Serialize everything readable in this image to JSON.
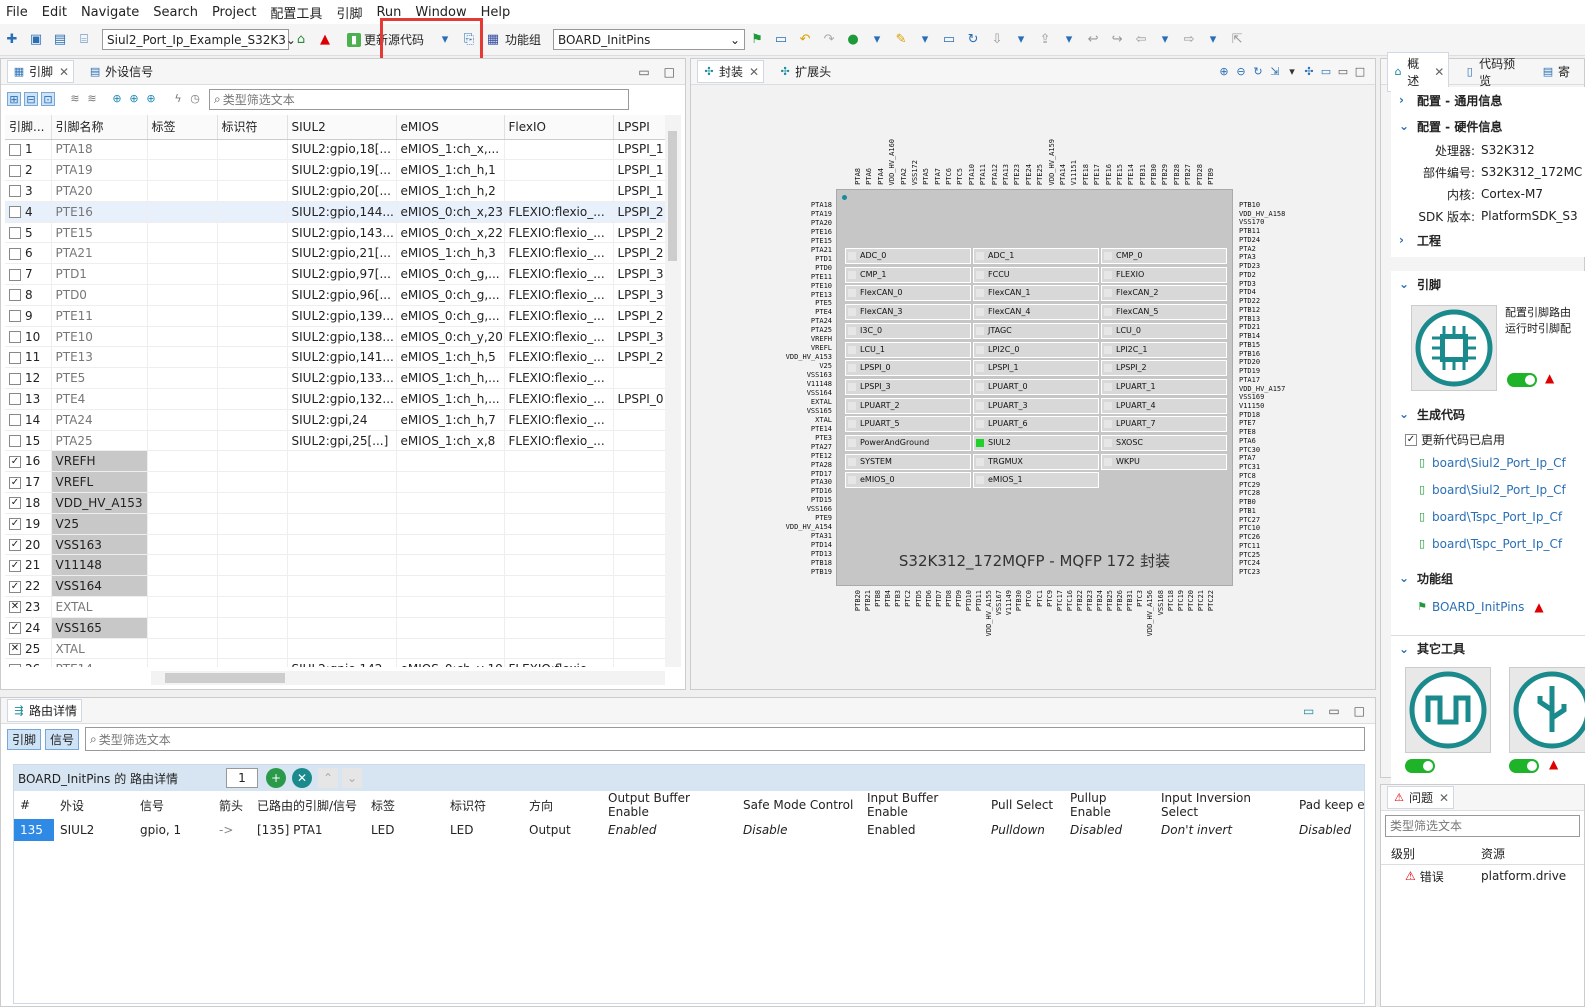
{
  "menu": [
    "File",
    "Edit",
    "Navigate",
    "Search",
    "Project",
    "配置工具",
    "引脚",
    "Run",
    "Window",
    "Help"
  ],
  "toolbar": {
    "project_combo": "Siul2_Port_Ip_Example_S32K3",
    "update_code": "更新源代码",
    "func_group_label": "功能组",
    "func_group_combo": "BOARD_InitPins"
  },
  "left_tabs": {
    "pins": "引脚",
    "peripherals": "外设信号"
  },
  "filter_placeholder": "类型筛选文本",
  "pin_table": {
    "headers": [
      "引脚...",
      "引脚名称",
      "标签",
      "标识符",
      "SIUL2",
      "eMIOS",
      "FlexIO",
      "LPSPI"
    ],
    "rows": [
      [
        "1",
        "PTA18",
        "",
        "",
        "SIUL2:gpio,18[...",
        "eMIOS_1:ch_x,...",
        "",
        "LPSPI_1"
      ],
      [
        "2",
        "PTA19",
        "",
        "",
        "SIUL2:gpio,19[...",
        "eMIOS_1:ch_h,1",
        "",
        "LPSPI_1"
      ],
      [
        "3",
        "PTA20",
        "",
        "",
        "SIUL2:gpio,20[...",
        "eMIOS_1:ch_h,2",
        "",
        "LPSPI_1"
      ],
      [
        "4",
        "PTE16",
        "",
        "",
        "SIUL2:gpio,144...",
        "eMIOS_0:ch_x,23",
        "FLEXIO:flexio_...",
        "LPSPI_2"
      ],
      [
        "5",
        "PTE15",
        "",
        "",
        "SIUL2:gpio,143...",
        "eMIOS_0:ch_x,22",
        "FLEXIO:flexio_...",
        "LPSPI_2"
      ],
      [
        "6",
        "PTA21",
        "",
        "",
        "SIUL2:gpio,21[...",
        "eMIOS_1:ch_h,3",
        "FLEXIO:flexio_...",
        "LPSPI_2"
      ],
      [
        "7",
        "PTD1",
        "",
        "",
        "SIUL2:gpio,97[...",
        "eMIOS_0:ch_g,...",
        "FLEXIO:flexio_...",
        "LPSPI_3"
      ],
      [
        "8",
        "PTD0",
        "",
        "",
        "SIUL2:gpio,96[...",
        "eMIOS_0:ch_g,...",
        "FLEXIO:flexio_...",
        "LPSPI_3"
      ],
      [
        "9",
        "PTE11",
        "",
        "",
        "SIUL2:gpio,139...",
        "eMIOS_0:ch_g,...",
        "FLEXIO:flexio_...",
        "LPSPI_2"
      ],
      [
        "10",
        "PTE10",
        "",
        "",
        "SIUL2:gpio,138...",
        "eMIOS_0:ch_y,20",
        "FLEXIO:flexio_...",
        "LPSPI_3"
      ],
      [
        "11",
        "PTE13",
        "",
        "",
        "SIUL2:gpio,141...",
        "eMIOS_1:ch_h,5",
        "FLEXIO:flexio_...",
        "LPSPI_2"
      ],
      [
        "12",
        "PTE5",
        "",
        "",
        "SIUL2:gpio,133...",
        "eMIOS_1:ch_h,...",
        "FLEXIO:flexio_...",
        ""
      ],
      [
        "13",
        "PTE4",
        "",
        "",
        "SIUL2:gpio,132...",
        "eMIOS_1:ch_h,...",
        "FLEXIO:flexio_...",
        "LPSPI_0"
      ],
      [
        "14",
        "PTA24",
        "",
        "",
        "SIUL2:gpi,24",
        "eMIOS_1:ch_h,7",
        "FLEXIO:flexio_...",
        ""
      ],
      [
        "15",
        "PTA25",
        "",
        "",
        "SIUL2:gpi,25[...]",
        "eMIOS_1:ch_x,8",
        "FLEXIO:flexio_...",
        ""
      ],
      [
        "16",
        "VREFH",
        "",
        "",
        "",
        "",
        "",
        ""
      ],
      [
        "17",
        "VREFL",
        "",
        "",
        "",
        "",
        "",
        ""
      ],
      [
        "18",
        "VDD_HV_A153",
        "",
        "",
        "",
        "",
        "",
        ""
      ],
      [
        "19",
        "V25",
        "",
        "",
        "",
        "",
        "",
        ""
      ],
      [
        "20",
        "VSS163",
        "",
        "",
        "",
        "",
        "",
        ""
      ],
      [
        "21",
        "V11148",
        "",
        "",
        "",
        "",
        "",
        ""
      ],
      [
        "22",
        "VSS164",
        "",
        "",
        "",
        "",
        "",
        ""
      ],
      [
        "23",
        "EXTAL",
        "",
        "",
        "",
        "",
        "",
        ""
      ],
      [
        "24",
        "VSS165",
        "",
        "",
        "",
        "",
        "",
        ""
      ],
      [
        "25",
        "XTAL",
        "",
        "",
        "",
        "",
        "",
        ""
      ],
      [
        "26",
        "PTE14",
        "",
        "",
        "SIUL2:gpio,142",
        "eMIOS_0:ch_y,19",
        "FLEXIO:flexio",
        ""
      ]
    ]
  },
  "center_tabs": {
    "package": "封装",
    "expansion": "扩展头"
  },
  "chip": {
    "caption": "S32K312_172MQFP - MQFP 172 封装",
    "top_pins": [
      "PTA8",
      "PTA6",
      "PTA4",
      "VDD_HV_A160",
      "PTA2",
      "VSS172",
      "PTA5",
      "PTA7",
      "PTC6",
      "PTC5",
      "PTA10",
      "PTA11",
      "PTA12",
      "PTA13",
      "PTE23",
      "PTE24",
      "PTE25",
      "VDD_HV_A159",
      "PTA14",
      "V11151",
      "PTE18",
      "PTE17",
      "PTE16",
      "PTE15",
      "PTE14",
      "PTB31",
      "PTB30",
      "PTB29",
      "PTB28",
      "PTB27",
      "PTD28",
      "PTB9"
    ],
    "left_pins": [
      "PTA18",
      "PTA19",
      "PTA20",
      "PTE16",
      "PTE15",
      "PTA21",
      "PTD1",
      "PTD0",
      "PTE11",
      "PTE10",
      "PTE13",
      "PTE5",
      "PTE4",
      "PTA24",
      "PTA25",
      "VREFH",
      "VREFL",
      "VDD_HV_A153",
      "V25",
      "VSS163",
      "V11148",
      "VSS164",
      "EXTAL",
      "VSS165",
      "XTAL",
      "PTE14",
      "PTE3",
      "PTA27",
      "PTE12",
      "PTA28",
      "PTD17",
      "PTA30",
      "PTD16",
      "PTD15",
      "VSS166",
      "PTE9",
      "VDD_HV_A154",
      "PTA31",
      "PTD14",
      "PTD13",
      "PTB18",
      "PTB19"
    ],
    "right_pins": [
      "PTB10",
      "VDD_HV_A158",
      "VSS170",
      "PTB11",
      "PTD24",
      "PTA2",
      "PTA3",
      "PTD23",
      "PTD2",
      "PTD3",
      "PTD4",
      "PTD22",
      "PTB12",
      "PTB13",
      "PTD21",
      "PTB14",
      "PTB15",
      "PTB16",
      "PTD20",
      "PTD19",
      "PTA17",
      "VDD_HV_A157",
      "VSS169",
      "V11150",
      "PTD18",
      "PTE7",
      "PTE8",
      "PTA6",
      "PTC30",
      "PTA7",
      "PTC31",
      "PTC8",
      "PTC29",
      "PTC28",
      "PTB0",
      "PTB1",
      "PTC27",
      "PTC10",
      "PTC26",
      "PTC11",
      "PTC25",
      "PTC24",
      "PTC23"
    ],
    "bottom_pins": [
      "PTB20",
      "PTB21",
      "PTB8",
      "PTB4",
      "PTB3",
      "PTC2",
      "PTD5",
      "PTD6",
      "PTD7",
      "PTD8",
      "PTD9",
      "PTD10",
      "PTD11",
      "VDD_HV_A155",
      "VSS167",
      "V11149",
      "PTB30",
      "PTC0",
      "PTC1",
      "PTC9",
      "PTC17",
      "PTC16",
      "PTB22",
      "PTB23",
      "PTB24",
      "PTB25",
      "PTB26",
      "PTB31",
      "PTC3",
      "VDD_HV_A156",
      "VSS168",
      "PTC18",
      "PTC19",
      "PTC20",
      "PTC21",
      "PTC22"
    ],
    "peripherals": [
      "ADC_0",
      "ADC_1",
      "CMP_0",
      "CMP_1",
      "FCCU",
      "FLEXIO",
      "FlexCAN_0",
      "FlexCAN_1",
      "FlexCAN_2",
      "FlexCAN_3",
      "FlexCAN_4",
      "FlexCAN_5",
      "I3C_0",
      "JTAGC",
      "LCU_0",
      "LCU_1",
      "LPI2C_0",
      "LPI2C_1",
      "LPSPI_0",
      "LPSPI_1",
      "LPSPI_2",
      "LPSPI_3",
      "LPUART_0",
      "LPUART_1",
      "LPUART_2",
      "LPUART_3",
      "LPUART_4",
      "LPUART_5",
      "LPUART_6",
      "LPUART_7",
      "PowerAndGround",
      "SIUL2",
      "SXOSC",
      "SYSTEM",
      "TRGMUX",
      "WKPU",
      "eMIOS_0",
      "eMIOS_1"
    ]
  },
  "routing": {
    "tab": "路由详情",
    "btn_pins": "引脚",
    "btn_signals": "信号",
    "filter_placeholder": "类型筛选文本",
    "title": "BOARD_InitPins 的 路由详情",
    "count": "1",
    "headers": [
      "#",
      "外设",
      "信号",
      "箭头",
      "已路由的引脚/信号",
      "标签",
      "标识符",
      "方向",
      "Output Buffer Enable",
      "Safe Mode Control",
      "Input Buffer Enable",
      "Pull Select",
      "Pullup Enable",
      "Input Inversion Select",
      "Pad keep e"
    ],
    "row": [
      "135",
      "SIUL2",
      "gpio, 1",
      "->",
      "[135] PTA1",
      "LED",
      "LED",
      "Output",
      "Enabled",
      "Disable",
      "Enabled",
      "Pulldown",
      "Disabled",
      "Don't invert",
      "Disabled"
    ]
  },
  "right": {
    "tabs": [
      "概述",
      "代码预览",
      "寄"
    ],
    "sec_general": "配置 - 通用信息",
    "sec_hw": "配置 - 硬件信息",
    "hw": [
      [
        "处理器:",
        "S32K312"
      ],
      [
        "部件编号:",
        "S32K312_172MC"
      ],
      [
        "内核:",
        "Cortex-M7"
      ],
      [
        "SDK 版本:",
        "PlatformSDK_S3"
      ]
    ],
    "sec_project": "工程",
    "sec_pins": "引脚",
    "pins_desc1": "配置引脚路由",
    "pins_desc2": "运行时引脚配",
    "sec_gen": "生成代码",
    "gen_enabled": "更新代码已启用",
    "gen_files": [
      "board\\Siul2_Port_Ip_Cf",
      "board\\Siul2_Port_Ip_Cf",
      "board\\Tspc_Port_Ip_Cf",
      "board\\Tspc_Port_Ip_Cf"
    ],
    "sec_func": "功能组",
    "func_item": "BOARD_InitPins",
    "sec_tools": "其它工具"
  },
  "problems": {
    "tab": "问题",
    "filter_placeholder": "类型筛选文本",
    "col_level": "级别",
    "col_resource": "资源",
    "row_level": "错误",
    "row_resource": "platform.drive"
  }
}
